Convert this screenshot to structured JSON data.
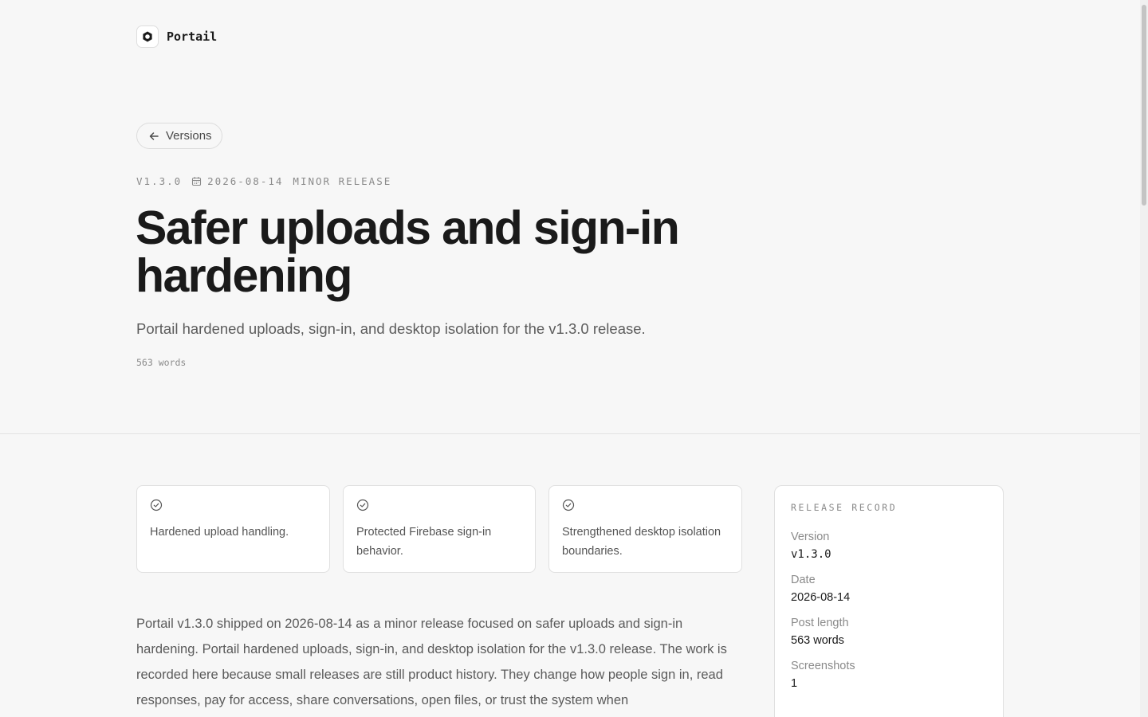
{
  "brand": {
    "name": "Portail"
  },
  "nav": {
    "back_label": "Versions"
  },
  "meta": {
    "version": "V1.3.0",
    "date": "2026-08-14",
    "type": "MINOR RELEASE"
  },
  "post": {
    "title": "Safer uploads and sign-in hardening",
    "subtitle": "Portail hardened uploads, sign-in, and desktop isolation for the v1.3.0 release.",
    "word_count": "563 words"
  },
  "highlights": [
    {
      "text": "Hardened upload handling."
    },
    {
      "text": "Protected Firebase sign-in behavior."
    },
    {
      "text": "Strengthened desktop isolation boundaries."
    }
  ],
  "body": "Portail v1.3.0 shipped on 2026-08-14 as a minor release focused on safer uploads and sign-in hardening. Portail hardened uploads, sign-in, and desktop isolation for the v1.3.0 release. The work is recorded here because small releases are still product history. They change how people sign in, read responses, pay for access, share conversations, open files, or trust the system when",
  "record": {
    "title": "RELEASE RECORD",
    "rows": [
      {
        "label": "Version",
        "value": "v1.3.0"
      },
      {
        "label": "Date",
        "value": "2026-08-14"
      },
      {
        "label": "Post length",
        "value": "563 words"
      },
      {
        "label": "Screenshots",
        "value": "1"
      }
    ]
  },
  "colors": {
    "background": "#f7f7f7",
    "text": "#1a1a1a",
    "muted": "#8a8a8a",
    "border": "#e0e0e0"
  }
}
